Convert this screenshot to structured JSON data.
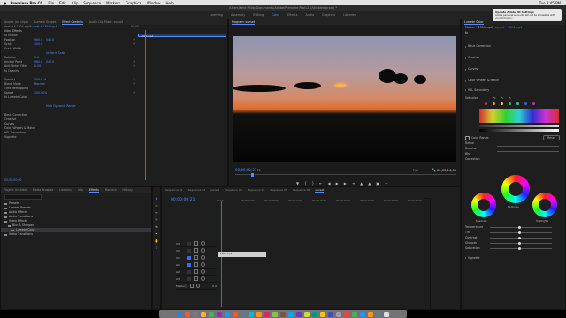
{
  "menubar": {
    "app": "Premiere Pro CC",
    "items": [
      "File",
      "Edit",
      "Clip",
      "Sequence",
      "Markers",
      "Graphics",
      "Window",
      "Help"
    ],
    "clock": "Tue 8:45 PM"
  },
  "title": "/Users/Kent Philip/Documents/Adobe/Premiere Pro/12.0/Untitled.prproj *",
  "workspaces": [
    "Learning",
    "Assembly",
    "Editing",
    "Color",
    "Effects",
    "Audio",
    "Graphics",
    "Libraries"
  ],
  "active_workspace": "Color",
  "notification": {
    "title": "Update Adobe ID Settings",
    "body": "Adobe personal accounts will not be accessible with your old log-in."
  },
  "effect_controls": {
    "tabs": [
      "Source: (no clips)",
      "Lumetri Scopes",
      "Effect Controls",
      "Audio Clip Mixer: sunset"
    ],
    "active_tab": "Effect Controls",
    "source": "Master * 1304.mp4",
    "clip": "sunset * 1304.mp4",
    "timecode_head": "00;00",
    "clip_bar_label": "1304.mp4",
    "section": "Video Effects",
    "rows": [
      {
        "label": "fx Motion",
        "v1": "",
        "v2": ""
      },
      {
        "label": "Position",
        "v1": "960.0",
        "v2": "540.0"
      },
      {
        "label": "Scale",
        "v1": "100.0",
        "v2": ""
      },
      {
        "label": "Scale Width",
        "v1": "",
        "v2": ""
      },
      {
        "label": "",
        "v1": "",
        "v2": "Uniform Scale"
      },
      {
        "label": "Rotation",
        "v1": "0.0",
        "v2": ""
      },
      {
        "label": "Anchor Point",
        "v1": "960.0",
        "v2": "540.0"
      },
      {
        "label": "Anti-flicker Filter",
        "v1": "0.00",
        "v2": ""
      },
      {
        "label": "fx Opacity",
        "v1": "",
        "v2": ""
      },
      {
        "label": "",
        "v1": "",
        "v2": ""
      },
      {
        "label": "Opacity",
        "v1": "100.0 %",
        "v2": ""
      },
      {
        "label": "Blend Mode",
        "v1": "Normal",
        "v2": ""
      },
      {
        "label": "Time Remapping",
        "v1": "",
        "v2": ""
      },
      {
        "label": "Speed",
        "v1": "100.00%",
        "v2": ""
      },
      {
        "label": "fx Lumetri Color",
        "v1": "",
        "v2": ""
      },
      {
        "label": "",
        "v1": "",
        "v2": ""
      },
      {
        "label": "",
        "v1": "",
        "v2": "High Dynamic Range"
      },
      {
        "label": "",
        "v1": "",
        "v2": ""
      },
      {
        "label": "Basic Correction",
        "v1": "",
        "v2": ""
      },
      {
        "label": "Creative",
        "v1": "",
        "v2": ""
      },
      {
        "label": "Curves",
        "v1": "",
        "v2": ""
      },
      {
        "label": "Color Wheels & Match",
        "v1": "",
        "v2": ""
      },
      {
        "label": "HSL Secondary",
        "v1": "",
        "v2": ""
      },
      {
        "label": "Vignette",
        "v1": "",
        "v2": ""
      }
    ],
    "timecode": "00;00;00;00"
  },
  "program": {
    "tab": "Program: sunset",
    "timecode": "00;00;00;21",
    "fit": "Fit",
    "quality": "Full",
    "duration": "00;00;14;04",
    "ruler": [
      "00;00",
      "00;00;04;00",
      "00;00;08;00",
      "00;00;12;00",
      "00;00;16;00"
    ]
  },
  "lumetri": {
    "tab": "Lumetri Color",
    "source": "Master * 1304.mp4",
    "clip": "sunset * 1304.mp4",
    "sections": [
      "Basic Correction",
      "Creative",
      "Curves",
      "Color Wheels & Match",
      "HSL Secondary"
    ],
    "set_color": "Set color",
    "color_range": "Color Range",
    "hsl_reset": "Reset",
    "refine": "Refine",
    "denoise": "Denoise",
    "blur": "Blur",
    "correction": "Correction",
    "wheel_labels": [
      "Midtones",
      "Shadows",
      "Highlights"
    ],
    "sliders": [
      "Temperature",
      "Tint",
      "Contrast",
      "Sharpen",
      "Saturation"
    ],
    "vignette": "Vignette",
    "swatches": [
      "#e03030",
      "#e0a020",
      "#e0e020",
      "#30c030",
      "#20c0c0",
      "#3060e0",
      "#c030c0"
    ]
  },
  "project": {
    "tabs": [
      "Project: Untitled",
      "Media Browser",
      "Libraries",
      "Info",
      "Effects",
      "Markers",
      "History"
    ],
    "active_tab": "Effects",
    "items": [
      "Presets",
      "Lumetri Presets",
      "Audio Effects",
      "Audio Transitions",
      "Video Effects",
      "Blur & Sharpen",
      "Lumetri Color",
      "Video Transitions"
    ]
  },
  "timeline": {
    "tabs": [
      "Sequence 01",
      "Sequence 02",
      "sunset",
      "Sequence 03",
      "Sequence 04",
      "Sequence 05",
      "Sequence 06",
      "sunset"
    ],
    "active_tab": "sunset",
    "timecode": "00;00;00;21",
    "ruler": [
      "00;00",
      "00;00;04;00",
      "00;00;08;00",
      "00;00;12;00",
      "00;00;16;00",
      "00;00;20;00",
      "00;00;24;00",
      "00;00;28;00",
      "00;00;32;00"
    ],
    "tracks": [
      "V3",
      "V2",
      "V1",
      "A1",
      "A2",
      "A3",
      "Master"
    ],
    "master_level": "0.0",
    "clip_label": "1304.mp4"
  },
  "dock_colors": [
    "#3a7bd5",
    "#e85d4a",
    "#7a7a7a",
    "#f2b33d",
    "#4caf50",
    "#9c27b0",
    "#2196f3",
    "#ff5722",
    "#607d8b",
    "#00bcd4",
    "#ff9800",
    "#e91e63",
    "#8bc34a",
    "#795548",
    "#03a9f4",
    "#673ab7",
    "#cddc39",
    "#009688",
    "#ffc107",
    "#3f51b5",
    "#9e9e9e",
    "#f44336",
    "#4caf50",
    "#2196f3",
    "#ff9800",
    "#607d8b",
    "#e0e0e0"
  ]
}
